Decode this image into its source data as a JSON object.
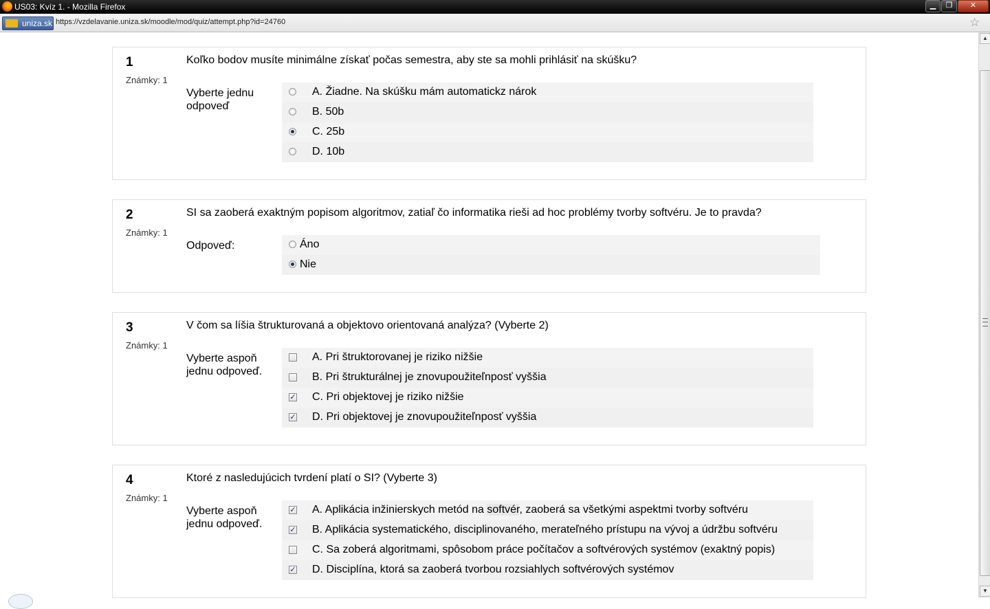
{
  "window": {
    "title": "US03: Kvíz 1. - Mozilla Firefox",
    "controls": {
      "minimize": "▁",
      "maximize": "❐",
      "close": "✕"
    }
  },
  "addressbar": {
    "site_identity": "uniza.sk",
    "url": "https://vzdelavanie.uniza.sk/moodle/mod/quiz/attempt.php?id=24760"
  },
  "questions": [
    {
      "number": "1",
      "grade": "Známky: 1",
      "text": "Koľko bodov musíte minimálne získať počas semestra, aby ste sa mohli prihlásiť na skúšku?",
      "prompt": "Vyberte jednu odpoveď",
      "type": "radio",
      "answers": [
        {
          "label": "A. Žiadne. Na skúšku mám automatickz nárok",
          "checked": false
        },
        {
          "label": "B. 50b",
          "checked": false
        },
        {
          "label": "C. 25b",
          "checked": true
        },
        {
          "label": "D. 10b",
          "checked": false
        }
      ]
    },
    {
      "number": "2",
      "grade": "Známky: 1",
      "text": "SI sa zaoberá exaktným popisom algoritmov, zatiaľ čo informatika rieši ad hoc problémy tvorby softvéru. Je to pravda?",
      "prompt": "Odpoveď:",
      "type": "radio",
      "answers": [
        {
          "label": "Áno",
          "checked": false
        },
        {
          "label": "Nie",
          "checked": true
        }
      ]
    },
    {
      "number": "3",
      "grade": "Známky: 1",
      "text": "V čom sa líšia štrukturovaná a objektovo orientovaná analýza? (Vyberte 2)",
      "prompt": "Vyberte aspoň jednu odpoveď.",
      "type": "checkbox",
      "answers": [
        {
          "label": "A. Pri štruktorovanej je riziko nižšie",
          "checked": false
        },
        {
          "label": "B. Pri štrukturálnej je znovupoužiteľnposť vyššia",
          "checked": false
        },
        {
          "label": "C. Pri objektovej je riziko nižšie",
          "checked": true
        },
        {
          "label": "D. Pri objektovej je znovupoužiteľnposť vyššia",
          "checked": true
        }
      ]
    },
    {
      "number": "4",
      "grade": "Známky: 1",
      "text": "Ktoré z nasledujúcich tvrdení platí o SI? (Vyberte 3)",
      "prompt": "Vyberte aspoň jednu odpoveď.",
      "type": "checkbox",
      "answers": [
        {
          "label_pre": "A. Aplikácia inžinierskych metód na ",
          "label_hl": "softvér",
          "label_post": ", zaoberá sa všetkými aspektmi tvorby softvéru",
          "checked": true
        },
        {
          "label": "B. Aplikácia systematického, disciplinovaného, merateľného prístupu na vývoj a údržbu softvéru",
          "checked": true
        },
        {
          "label": "C. Sa zoberá algoritmami, spôsobom práce počítačov a softvérových systémov (exaktný popis)",
          "checked": false
        },
        {
          "label": "D. Disciplína, ktorá sa zaoberá tvorbou rozsiahlych softvérových systémov",
          "checked": true
        }
      ]
    }
  ],
  "checkmark_glyph": "✓"
}
